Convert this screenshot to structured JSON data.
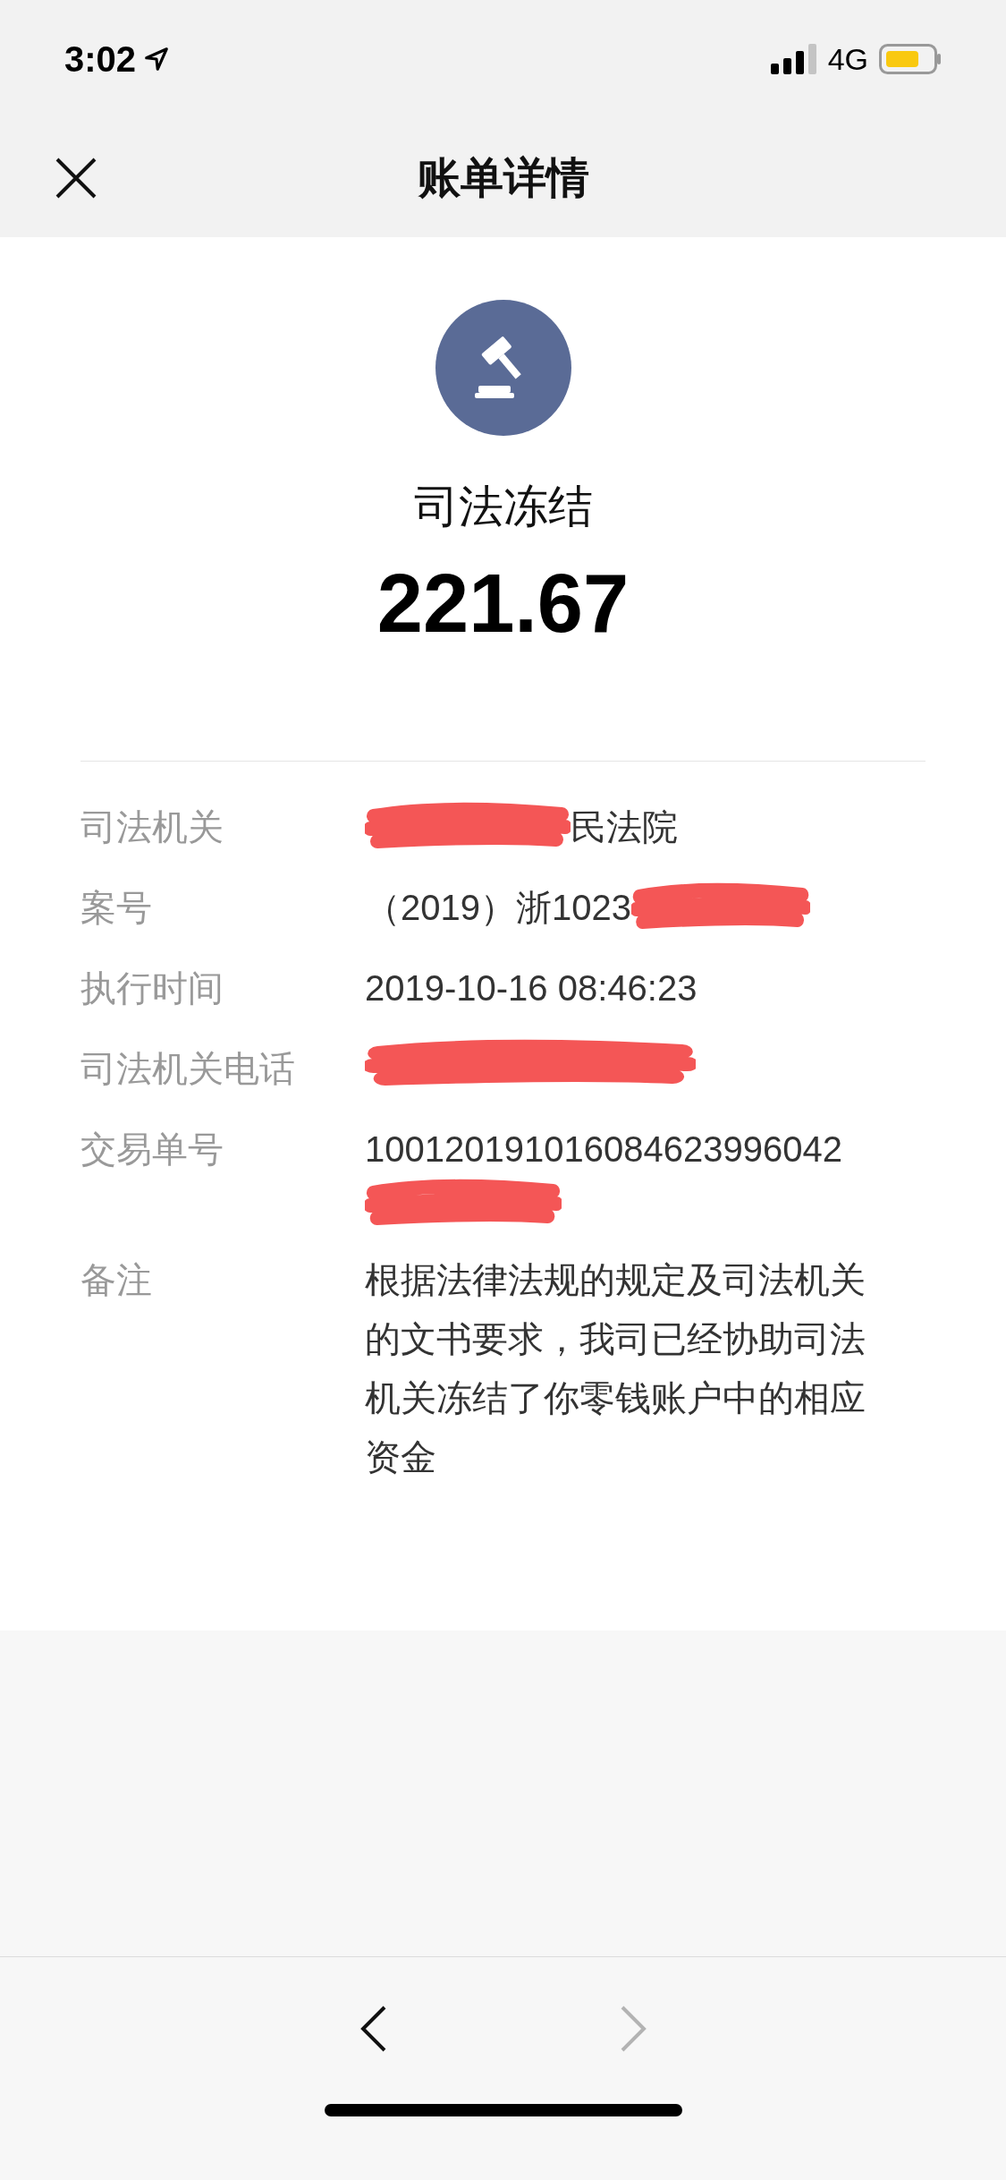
{
  "status_bar": {
    "time": "3:02",
    "network": "4G"
  },
  "nav": {
    "title": "账单详情"
  },
  "summary": {
    "title": "司法冻结",
    "amount": "221.67"
  },
  "details": [
    {
      "label": "司法机关",
      "value": "民法院",
      "kind": "premasked"
    },
    {
      "label": "案号",
      "value": "（2019）浙1023",
      "kind": "postmasked"
    },
    {
      "label": "执行时间",
      "value": "2019-10-16 08:46:23",
      "kind": "plain"
    },
    {
      "label": "司法机关电话",
      "kind": "masked"
    },
    {
      "label": "交易单号",
      "value": "100120191016084623996042",
      "kind": "undermasked"
    },
    {
      "label": "备注",
      "value": "根据法律法规的规定及司法机关的文书要求，我司已经协助司法机关冻结了你零钱账户中的相应资金",
      "kind": "plain"
    }
  ],
  "toolbar": {
    "back_enabled": true,
    "forward_enabled": false
  }
}
